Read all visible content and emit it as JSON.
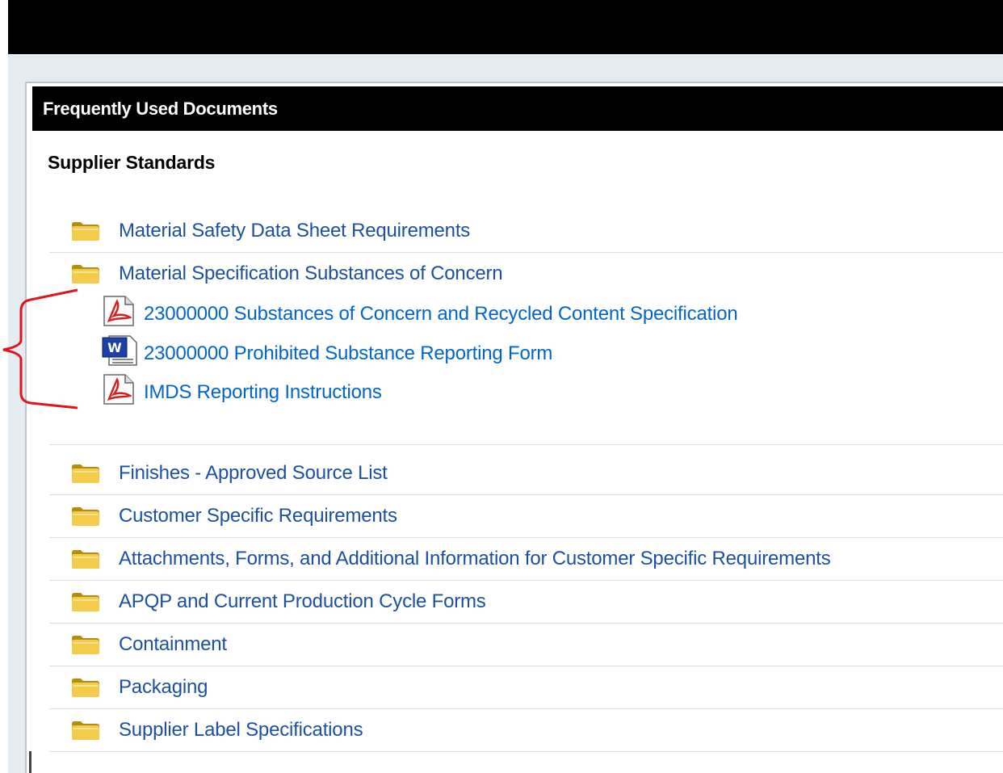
{
  "panel": {
    "header": "Frequently Used Documents",
    "section_title": "Supplier Standards"
  },
  "folders_top": [
    {
      "label": "Material Safety Data Sheet Requirements",
      "icon": "folder-icon"
    },
    {
      "label": "Material Specification Substances of Concern",
      "icon": "folder-icon"
    }
  ],
  "documents": [
    {
      "label": "23000000 Substances of Concern and Recycled Content Specification",
      "icon": "pdf-icon"
    },
    {
      "label": "23000000 Prohibited Substance Reporting Form",
      "icon": "word-icon"
    },
    {
      "label": "IMDS Reporting Instructions",
      "icon": "pdf-icon"
    }
  ],
  "folders_bottom": [
    {
      "label": "Finishes - Approved Source List",
      "icon": "folder-icon"
    },
    {
      "label": "Customer Specific Requirements",
      "icon": "folder-icon"
    },
    {
      "label": "Attachments, Forms, and Additional Information for Customer Specific Requirements",
      "icon": "folder-icon"
    },
    {
      "label": "APQP and Current Production Cycle Forms",
      "icon": "folder-icon"
    },
    {
      "label": "Containment",
      "icon": "folder-icon"
    },
    {
      "label": "Packaging",
      "icon": "folder-icon"
    },
    {
      "label": "Supplier Label Specifications",
      "icon": "folder-icon"
    }
  ],
  "colors": {
    "folder_link": "#1b50a2",
    "doc_link": "#0066cc",
    "annotation_brace": "#e0151b"
  }
}
